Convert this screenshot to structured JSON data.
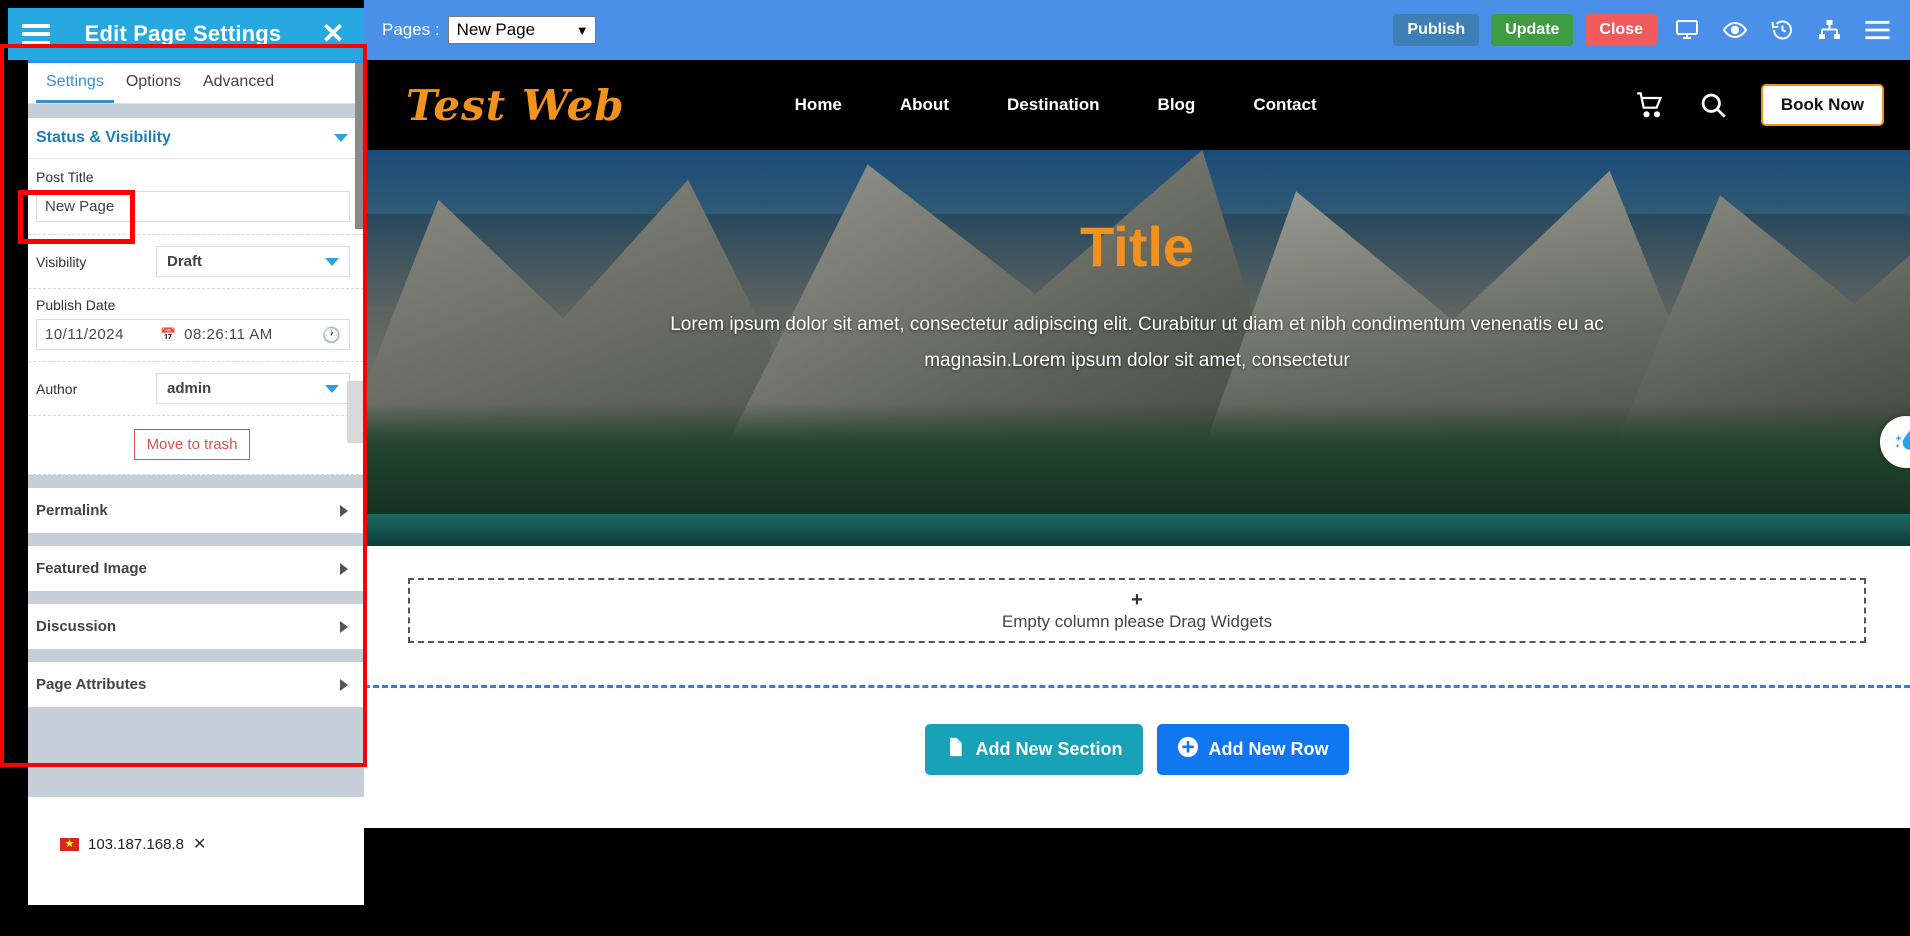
{
  "sidebar": {
    "header": {
      "menu_icon": "hamburger-icon",
      "title": "Edit Page Settings",
      "close_icon": "close-icon"
    },
    "tabs": [
      {
        "label": "Settings",
        "active": true
      },
      {
        "label": "Options",
        "active": false
      },
      {
        "label": "Advanced",
        "active": false
      }
    ],
    "status_section": {
      "title": "Status & Visibility",
      "caret": "chevron-down-icon"
    },
    "post_title": {
      "label": "Post Title",
      "value": "New Page",
      "placeholder": "Post Title"
    },
    "visibility": {
      "label": "Visibility",
      "value": "Draft",
      "caret": "chevron-down-icon"
    },
    "publish_date": {
      "label": "Publish Date",
      "date": "10/11/2024",
      "time": "08:26:11  AM",
      "calendar_icon": "calendar-icon",
      "clock_icon": "clock-icon"
    },
    "author": {
      "label": "Author",
      "value": "admin",
      "caret": "chevron-down-icon"
    },
    "trash_button": "Move to trash",
    "panels": [
      {
        "label": "Permalink",
        "caret": "chevron-right-icon"
      },
      {
        "label": "Featured Image",
        "caret": "chevron-right-icon"
      },
      {
        "label": "Discussion",
        "caret": "chevron-right-icon"
      },
      {
        "label": "Page Attributes",
        "caret": "chevron-right-icon"
      }
    ],
    "ip_badge": {
      "flag": "vietnam-flag-icon",
      "ip": "103.187.168.8",
      "close": "close-icon"
    }
  },
  "topbar": {
    "pages_label": "Pages :",
    "pages_selected": "New Page",
    "buttons": [
      {
        "label": "Publish",
        "color": "#3d7fb5"
      },
      {
        "label": "Update",
        "color": "#3f9c41"
      },
      {
        "label": "Close",
        "color": "#f05a5a"
      }
    ],
    "icons": [
      "desktop-icon",
      "eye-icon",
      "history-icon",
      "sitemap-icon",
      "hamburger-icon"
    ]
  },
  "site": {
    "logo": "Test Web",
    "nav": [
      "Home",
      "About",
      "Destination",
      "Blog",
      "Contact"
    ],
    "cart_icon": "cart-icon",
    "search_icon": "search-icon",
    "book_button": "Book Now",
    "hero": {
      "title": "Title",
      "subtitle": "Lorem ipsum dolor sit amet, consectetur adipiscing elit. Curabitur ut diam et nibh condimentum venenatis eu ac magnasin.Lorem ipsum dolor sit amet, consectetur"
    },
    "drop_area": {
      "plus": "+",
      "text": "Empty column please Drag Widgets"
    },
    "actions": [
      {
        "label": "Add New Section",
        "icon": "document-icon",
        "color": "#17a2b8"
      },
      {
        "label": "Add New Row",
        "icon": "plus-circle-icon",
        "color": "#1177f0"
      }
    ],
    "water_tab_icon": "water-drop-icon"
  },
  "colors": {
    "sidebar_header": "#28a8e0",
    "topbar": "#4a90e8",
    "accent_orange": "#f2921d",
    "annotation_red": "#fe0000",
    "tab_active": "#3a8fd4"
  }
}
